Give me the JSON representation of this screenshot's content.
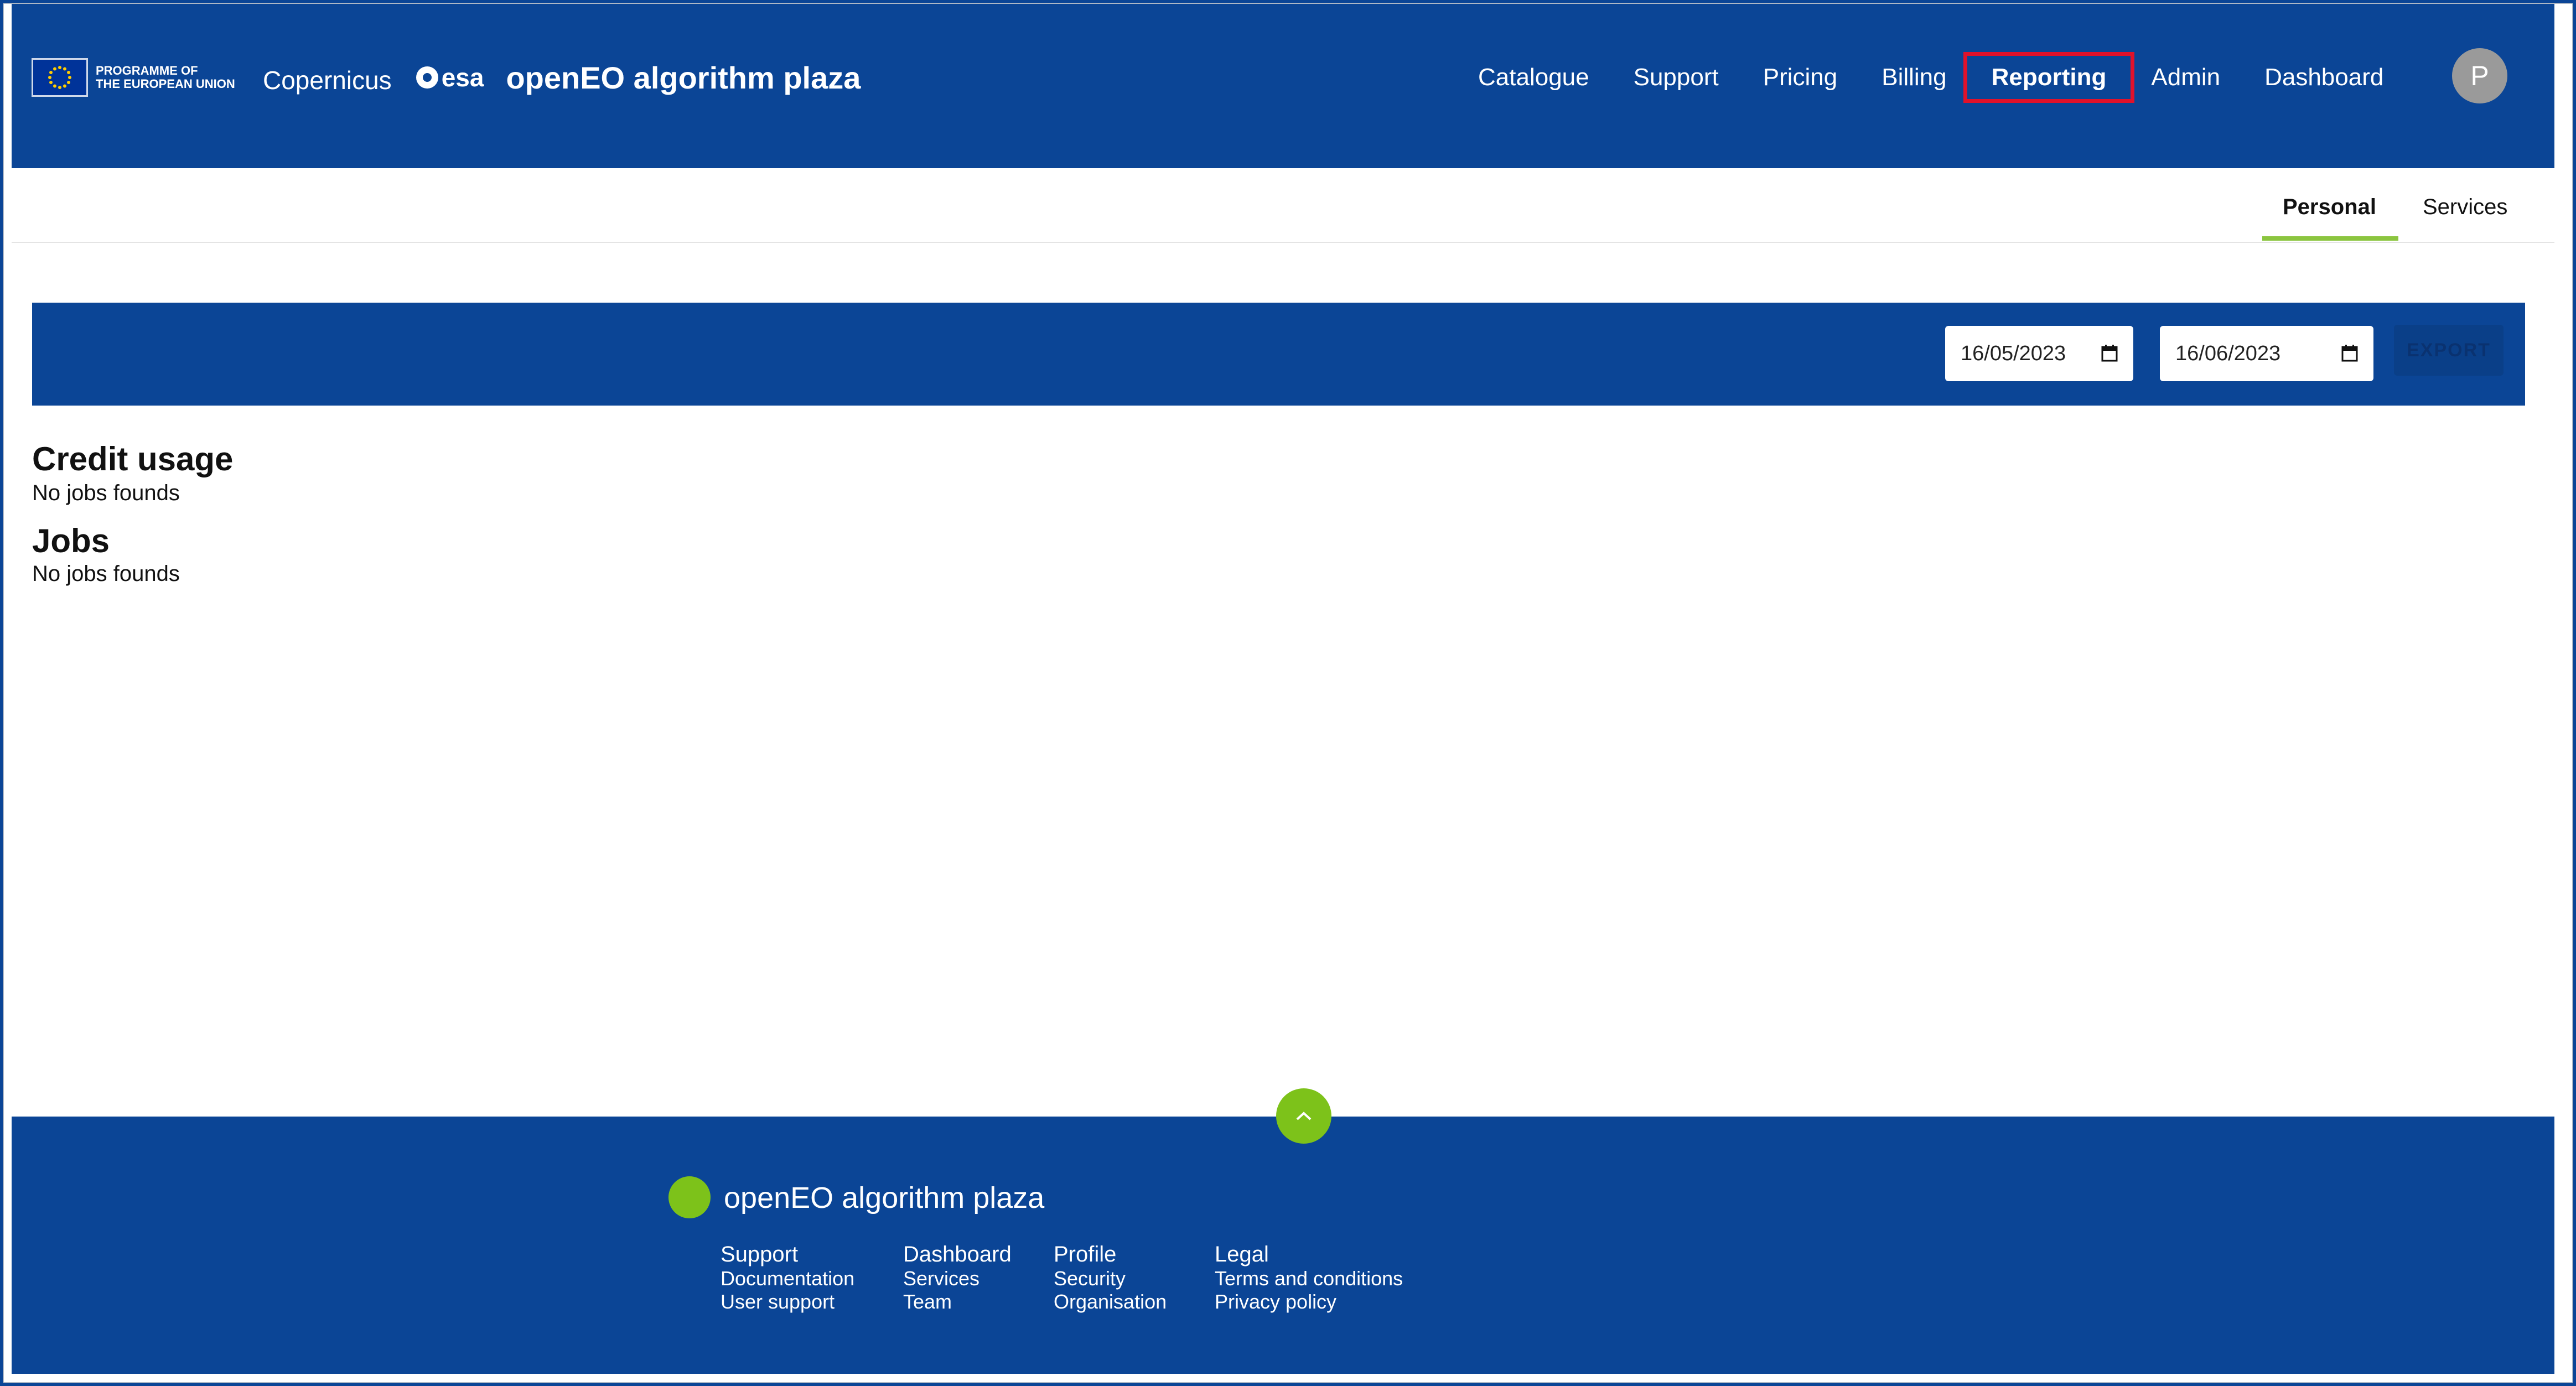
{
  "header": {
    "eu_programme_line1": "PROGRAMME OF",
    "eu_programme_line2": "THE EUROPEAN UNION",
    "copernicus_logo": "Copernicus",
    "esa_logo": "esa",
    "app_title": "openEO algorithm plaza",
    "nav": [
      {
        "label": "Catalogue"
      },
      {
        "label": "Support"
      },
      {
        "label": "Pricing"
      },
      {
        "label": "Billing"
      },
      {
        "label": "Reporting",
        "active": true
      },
      {
        "label": "Admin"
      },
      {
        "label": "Dashboard"
      }
    ],
    "avatar_initial": "P"
  },
  "subtabs": {
    "personal": "Personal",
    "services": "Services",
    "active": "Personal"
  },
  "filters": {
    "start_date": "16/05/2023",
    "end_date": "16/06/2023",
    "export_label": "EXPORT"
  },
  "content": {
    "credit_usage_title": "Credit usage",
    "credit_usage_empty": "No jobs founds",
    "jobs_title": "Jobs",
    "jobs_empty": "No jobs founds"
  },
  "footer": {
    "title": "openEO algorithm plaza",
    "columns": [
      {
        "heading": "Support",
        "links": [
          "Documentation",
          "User support"
        ]
      },
      {
        "heading": "Dashboard",
        "links": [
          "Services",
          "Team"
        ]
      },
      {
        "heading": "Profile",
        "links": [
          "Security",
          "Organisation"
        ]
      },
      {
        "heading": "Legal",
        "links": [
          "Terms and conditions",
          "Privacy policy"
        ]
      }
    ]
  },
  "colors": {
    "brand_blue": "#0b4596",
    "accent_green": "#7dc21a",
    "highlight_red": "#e0122b"
  },
  "icons": [
    "eu-flag-icon",
    "calendar-icon",
    "chevron-up-icon"
  ]
}
